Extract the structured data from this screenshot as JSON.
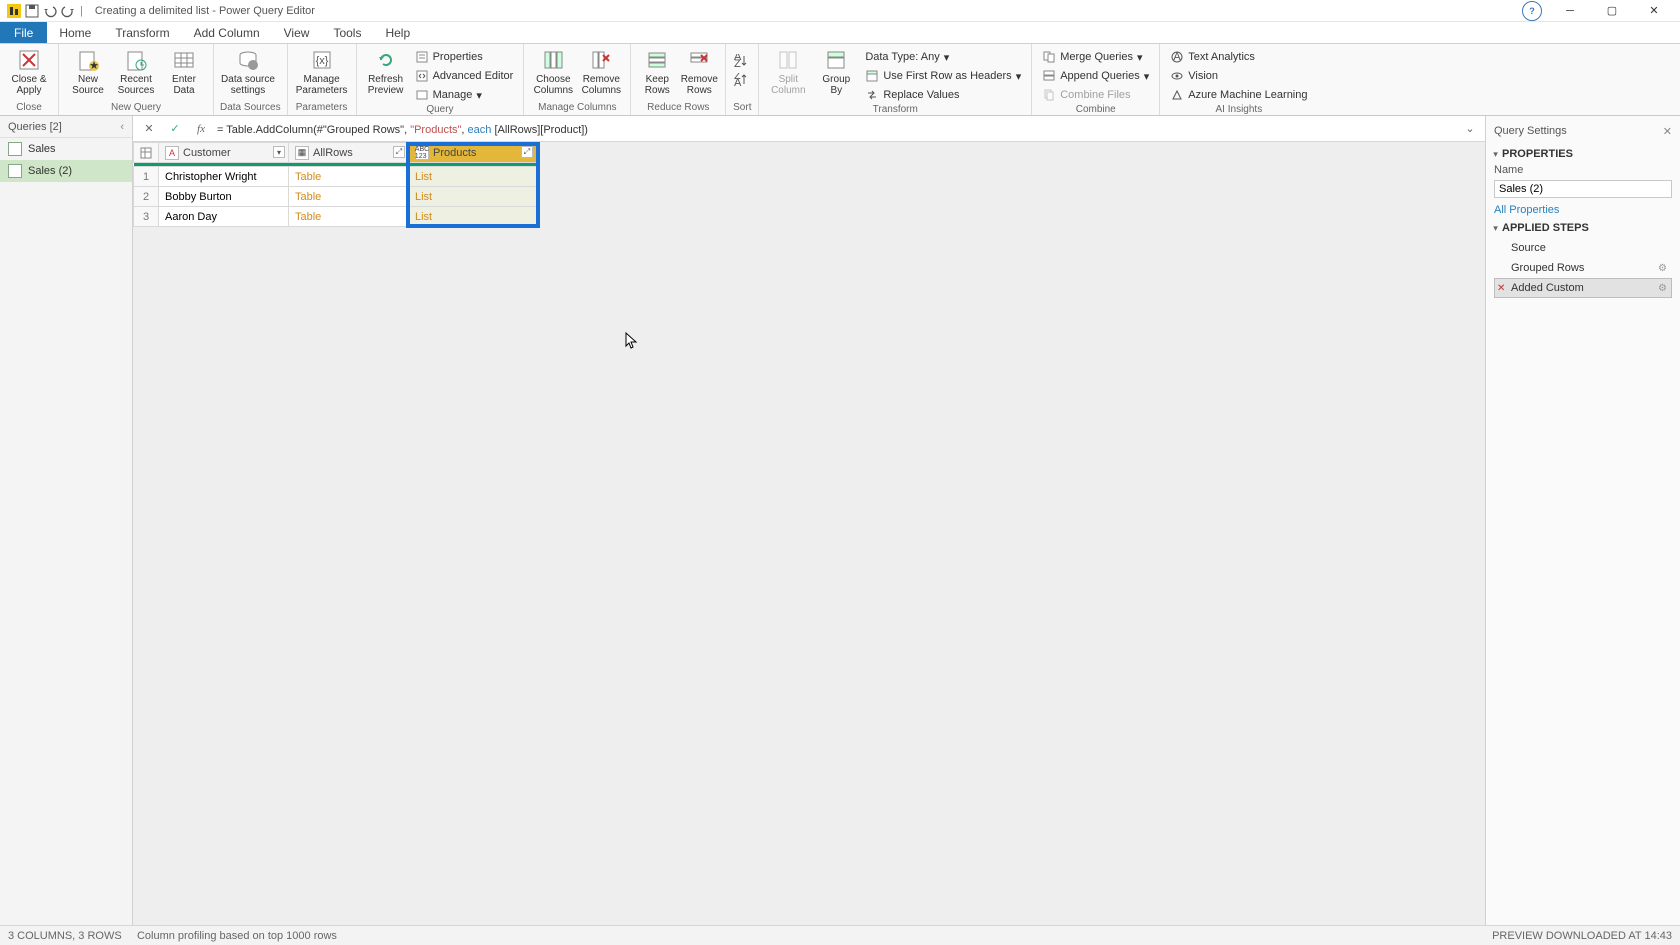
{
  "titlebar": {
    "title": "Creating a delimited list - Power Query Editor"
  },
  "tabs": {
    "file": "File",
    "home": "Home",
    "transform": "Transform",
    "addcolumn": "Add Column",
    "view": "View",
    "tools": "Tools",
    "help": "Help"
  },
  "ribbon": {
    "close": {
      "close_apply": "Close &\nApply",
      "group": "Close"
    },
    "newquery": {
      "new_source": "New\nSource",
      "recent_sources": "Recent\nSources",
      "enter_data": "Enter\nData",
      "group": "New Query"
    },
    "datasources": {
      "ds_settings": "Data source\nsettings",
      "group": "Data Sources"
    },
    "parameters": {
      "manage_params": "Manage\nParameters",
      "group": "Parameters"
    },
    "query": {
      "refresh": "Refresh\nPreview",
      "properties": "Properties",
      "adv_editor": "Advanced Editor",
      "manage": "Manage",
      "group": "Query"
    },
    "managecols": {
      "choose": "Choose\nColumns",
      "remove": "Remove\nColumns",
      "group": "Manage Columns"
    },
    "reducerows": {
      "keep": "Keep\nRows",
      "remove": "Remove\nRows",
      "group": "Reduce Rows"
    },
    "sort": {
      "group": "Sort"
    },
    "transform": {
      "split": "Split\nColumn",
      "groupby": "Group\nBy",
      "datatype": "Data Type: Any",
      "firstrow": "Use First Row as Headers",
      "replace": "Replace Values",
      "group": "Transform"
    },
    "combine": {
      "merge": "Merge Queries",
      "append": "Append Queries",
      "combinefiles": "Combine Files",
      "group": "Combine"
    },
    "ai": {
      "text": "Text Analytics",
      "vision": "Vision",
      "azure": "Azure Machine Learning",
      "group": "AI Insights"
    }
  },
  "queries": {
    "header": "Queries [2]",
    "items": [
      "Sales",
      "Sales (2)"
    ]
  },
  "formula": {
    "prefix": "= Table.AddColumn(#\"Grouped Rows\", ",
    "str": "\"Products\"",
    "mid": ", ",
    "kw": "each",
    "suffix": " [AllRows][Product])"
  },
  "grid": {
    "columns": [
      "Customer",
      "AllRows",
      "Products"
    ],
    "rows": [
      {
        "n": "1",
        "customer": "Christopher Wright",
        "allrows": "Table",
        "products": "List"
      },
      {
        "n": "2",
        "customer": "Bobby Burton",
        "allrows": "Table",
        "products": "List"
      },
      {
        "n": "3",
        "customer": "Aaron Day",
        "allrows": "Table",
        "products": "List"
      }
    ]
  },
  "settings": {
    "title": "Query Settings",
    "properties": "PROPERTIES",
    "name_label": "Name",
    "name_value": "Sales (2)",
    "all_props": "All Properties",
    "applied": "APPLIED STEPS",
    "steps": [
      "Source",
      "Grouped Rows",
      "Added Custom"
    ]
  },
  "status": {
    "left1": "3 COLUMNS, 3 ROWS",
    "left2": "Column profiling based on top 1000 rows",
    "right": "PREVIEW DOWNLOADED AT 14:43"
  }
}
